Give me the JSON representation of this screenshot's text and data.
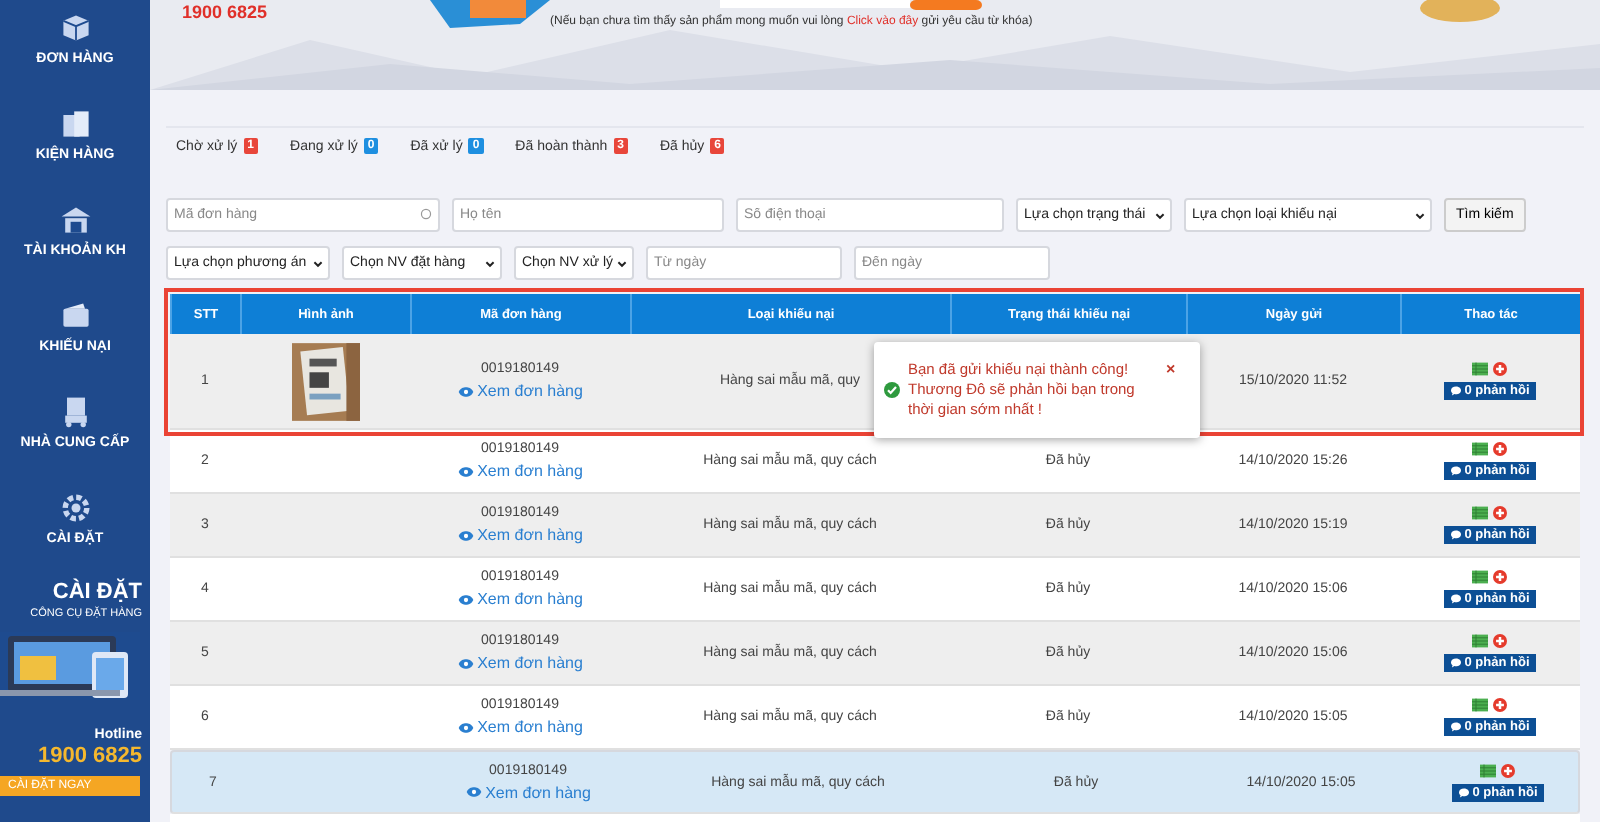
{
  "header": {
    "hotline": "1900 6825",
    "note_before": "(Nếu bạn chưa tìm thấy sản phẩm mong muốn vui lòng ",
    "note_link": "Click vào đây",
    "note_after": " gửi yêu cầu từ khóa)"
  },
  "sidebar": {
    "items": [
      {
        "label": "ĐƠN HÀNG"
      },
      {
        "label": "KIỆN HÀNG"
      },
      {
        "label": "TÀI KHOẢN KH"
      },
      {
        "label": "KHIẾU NẠI"
      },
      {
        "label": "NHÀ CUNG CẤP"
      },
      {
        "label": "CÀI ĐẶT"
      }
    ],
    "promo": {
      "title": "CÀI ĐẶT",
      "subtitle": "CÔNG CỤ ĐẶT HÀNG",
      "hotline_label": "Hotline",
      "hotline": "1900 6825",
      "button": "CÀI ĐẶT NGAY"
    }
  },
  "tabs": [
    {
      "label": "Chờ xử lý",
      "count": "1",
      "color": "#e8463a"
    },
    {
      "label": "Đang xử lý",
      "count": "0",
      "color": "#1e8fe0"
    },
    {
      "label": "Đã xử lý",
      "count": "0",
      "color": "#1e8fe0"
    },
    {
      "label": "Đã hoàn thành",
      "count": "3",
      "color": "#e8463a"
    },
    {
      "label": "Đã hủy",
      "count": "6",
      "color": "#e8463a"
    }
  ],
  "filters": {
    "row_1": [
      {
        "kind": "input",
        "placeholder": "Mã đơn hàng"
      },
      {
        "kind": "input",
        "placeholder": "Họ tên"
      },
      {
        "kind": "input",
        "placeholder": "Số điện thoại"
      },
      {
        "kind": "select",
        "value": "Lựa chọn trạng thái"
      },
      {
        "kind": "select",
        "value": "Lựa chọn loại khiếu nại"
      }
    ],
    "search_button": "Tìm kiếm",
    "row_2": [
      {
        "kind": "select",
        "value": "Lựa chọn phương án"
      },
      {
        "kind": "select",
        "value": "Chọn NV đặt hàng"
      },
      {
        "kind": "select",
        "value": "Chọn NV xử lý"
      },
      {
        "kind": "input",
        "placeholder": "Từ ngày"
      },
      {
        "kind": "input",
        "placeholder": "Đến ngày"
      }
    ]
  },
  "table": {
    "columns": [
      "STT",
      "Hình ảnh",
      "Mã đơn hàng",
      "Loại khiếu nại",
      "Trạng thái khiếu nại",
      "Ngày gửi",
      "Thao tác"
    ],
    "rows": [
      {
        "stt": "1",
        "order_code": "0019180149",
        "link": "Xem đơn hàng",
        "complaint_type": "Hàng sai mẫu mã, quy",
        "date": "15/10/2020 11:52",
        "replies": "0 phản hồi",
        "selected": false
      },
      {
        "stt": "2",
        "order_code": "0019180149",
        "link": "Xem đơn hàng",
        "complaint_type": "Hàng sai mẫu mã, quy cách",
        "status": "Đã hủy",
        "date": "14/10/2020 15:26",
        "replies": "0 phản hồi",
        "selected": false
      },
      {
        "stt": "3",
        "order_code": "0019180149",
        "link": "Xem đơn hàng",
        "complaint_type": "Hàng sai mẫu mã, quy cách",
        "status": "Đã hủy",
        "date": "14/10/2020 15:19",
        "replies": "0 phản hồi",
        "selected": false
      },
      {
        "stt": "4",
        "order_code": "0019180149",
        "link": "Xem đơn hàng",
        "complaint_type": "Hàng sai mẫu mã, quy cách",
        "status": "Đã hủy",
        "date": "14/10/2020 15:06",
        "replies": "0 phản hồi",
        "selected": false
      },
      {
        "stt": "5",
        "order_code": "0019180149",
        "link": "Xem đơn hàng",
        "complaint_type": "Hàng sai mẫu mã, quy cách",
        "status": "Đã hủy",
        "date": "14/10/2020 15:06",
        "replies": "0 phản hồi",
        "selected": false
      },
      {
        "stt": "6",
        "order_code": "0019180149",
        "link": "Xem đơn hàng",
        "complaint_type": "Hàng sai mẫu mã, quy cách",
        "status": "Đã hủy",
        "date": "14/10/2020 15:05",
        "replies": "0 phản hồi",
        "selected": false
      },
      {
        "stt": "7",
        "order_code": "0019180149",
        "link": "Xem đơn hàng",
        "complaint_type": "Hàng sai mẫu mã, quy cách",
        "status": "Đã hủy",
        "date": "14/10/2020 15:05",
        "replies": "0 phản hồi",
        "selected": true
      }
    ]
  },
  "toast": {
    "message": "Bạn đã gửi khiếu nại thành công! Thương Đô sẽ phản hồi bạn trong thời gian sớm nhất !",
    "close": "×"
  }
}
